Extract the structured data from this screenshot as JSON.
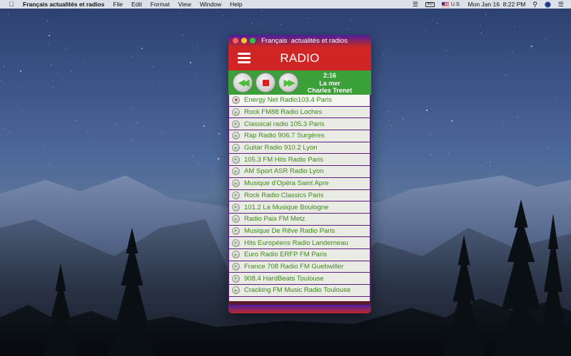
{
  "menubar": {
    "app_name": "Français actualités et radios",
    "menus": [
      "File",
      "Edit",
      "Format",
      "View",
      "Window",
      "Help"
    ],
    "battery_label": "ΦD",
    "input_source": "U.S.",
    "datetime": "Mon Jan 16  8:22 PM"
  },
  "window": {
    "title": "Français  actualités et radios",
    "header_title": "RADIO",
    "player": {
      "time": "2:16",
      "song": "La mer",
      "artist": "Charles Trenet"
    },
    "stations": [
      "Energy Net Radio103.4 Paris",
      "Rock FM88 Radio Loches",
      "Classical radio 105.3 Paris",
      "Rap Radio 906.7 Surgères",
      "Guitar Radio 910.2 Lyon",
      "105.3 FM Hits Radio Paris",
      "AM Sport ASR Radio Lyon",
      "Musique d'Opéra Saint Apre",
      "Rock Radio Classics Paris",
      "101.2 La Musique Boulogne",
      "Radio Paix FM Metz",
      "Musique De Rêve Radio Paris",
      "Hits Européens Radio Landerneau",
      "Euro Radio ERFP FM Paris",
      "France 708 Radio FM Guebwiller",
      "908.4 HardBeats Toulouse",
      "Cracking FM Music Radio Toulouse"
    ],
    "playing_index": 0
  },
  "colors": {
    "header_red": "#d02524",
    "player_green": "#3aa037",
    "list_text_green": "#3e8a1c",
    "divider_purple": "#5a1e7a"
  }
}
